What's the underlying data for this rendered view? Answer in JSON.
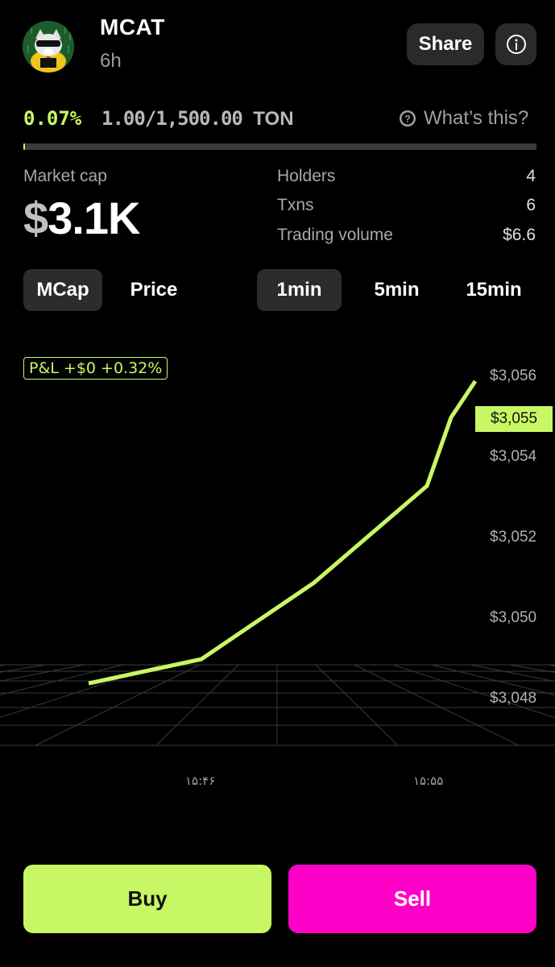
{
  "token": {
    "name": "MCAT",
    "age": "6h"
  },
  "header": {
    "share_label": "Share"
  },
  "progress": {
    "percent_text": "0.07%",
    "raised_text": "1.00/1,500.00",
    "unit": "TON",
    "fraction": 0.0007,
    "help_label": "What’s this?"
  },
  "stats": {
    "market_cap_label": "Market cap",
    "market_cap_symbol": "$",
    "market_cap_value": "3.1K",
    "rows": [
      {
        "label": "Holders",
        "value": "4"
      },
      {
        "label": "Txns",
        "value": "6"
      },
      {
        "label": "Trading volume",
        "value": "$6.6"
      }
    ]
  },
  "toggles": {
    "metric": [
      "MCap",
      "Price"
    ],
    "intervals": [
      "1min",
      "5min",
      "15min"
    ],
    "active_metric": "MCap",
    "active_interval": "1min"
  },
  "chart_data": {
    "type": "line",
    "pnl_label": "P&L +$0 +0.32%",
    "current_value_label": "$3,055",
    "y_ticks": [
      "$3,056",
      "$3,054",
      "$3,052",
      "$3,050",
      "$3,048"
    ],
    "x_ticks": [
      "۱۵:۴۶",
      "۱۵:۵۵"
    ],
    "ylim": [
      3047.6,
      3056.4
    ],
    "x": [
      "15:43",
      "15:46",
      "15:49",
      "15:52",
      "15:54",
      "15:55"
    ],
    "values": [
      3048.4,
      3049.0,
      3050.9,
      3053.3,
      3055.0,
      3055.9
    ],
    "line_color": "#c8f765"
  },
  "actions": {
    "buy_label": "Buy",
    "sell_label": "Sell"
  },
  "colors": {
    "accent": "#c8f765",
    "sell": "#ff00c8",
    "background": "#000000"
  }
}
